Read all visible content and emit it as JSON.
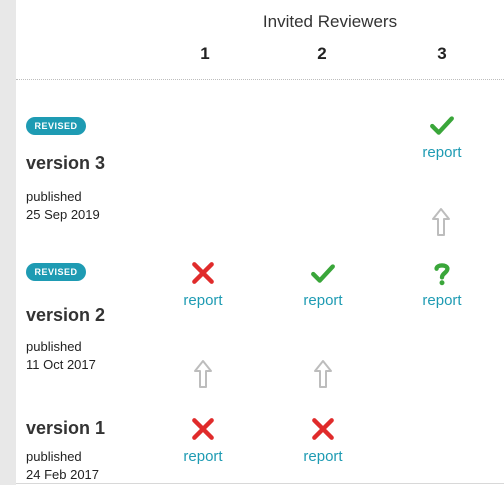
{
  "header": {
    "title": "Invited Reviewers",
    "columns": [
      "1",
      "2",
      "3"
    ]
  },
  "versions": [
    {
      "badge": "REVISED",
      "title": "version 3",
      "published_label": "published",
      "date": "25 Sep 2019"
    },
    {
      "badge": "REVISED",
      "title": "version 2",
      "published_label": "published",
      "date": "11 Oct 2017"
    },
    {
      "title": "version 1",
      "published_label": "published",
      "date": "24 Feb 2017"
    }
  ],
  "reviews": {
    "v3_r3": {
      "status": "approved",
      "link": "report"
    },
    "v2_r1": {
      "status": "not-approved",
      "link": "report"
    },
    "v2_r2": {
      "status": "approved",
      "link": "report"
    },
    "v2_r3": {
      "status": "approved-with-reservations",
      "link": "report"
    },
    "v1_r1": {
      "status": "not-approved",
      "link": "report"
    },
    "v1_r2": {
      "status": "not-approved",
      "link": "report"
    }
  },
  "colors": {
    "approved": "#3aa63a",
    "not_approved": "#e02b2b",
    "reservations": "#3aa63a",
    "link": "#1e9bb3",
    "badge": "#1e9bb3",
    "arrow": "#bdbdbd"
  }
}
